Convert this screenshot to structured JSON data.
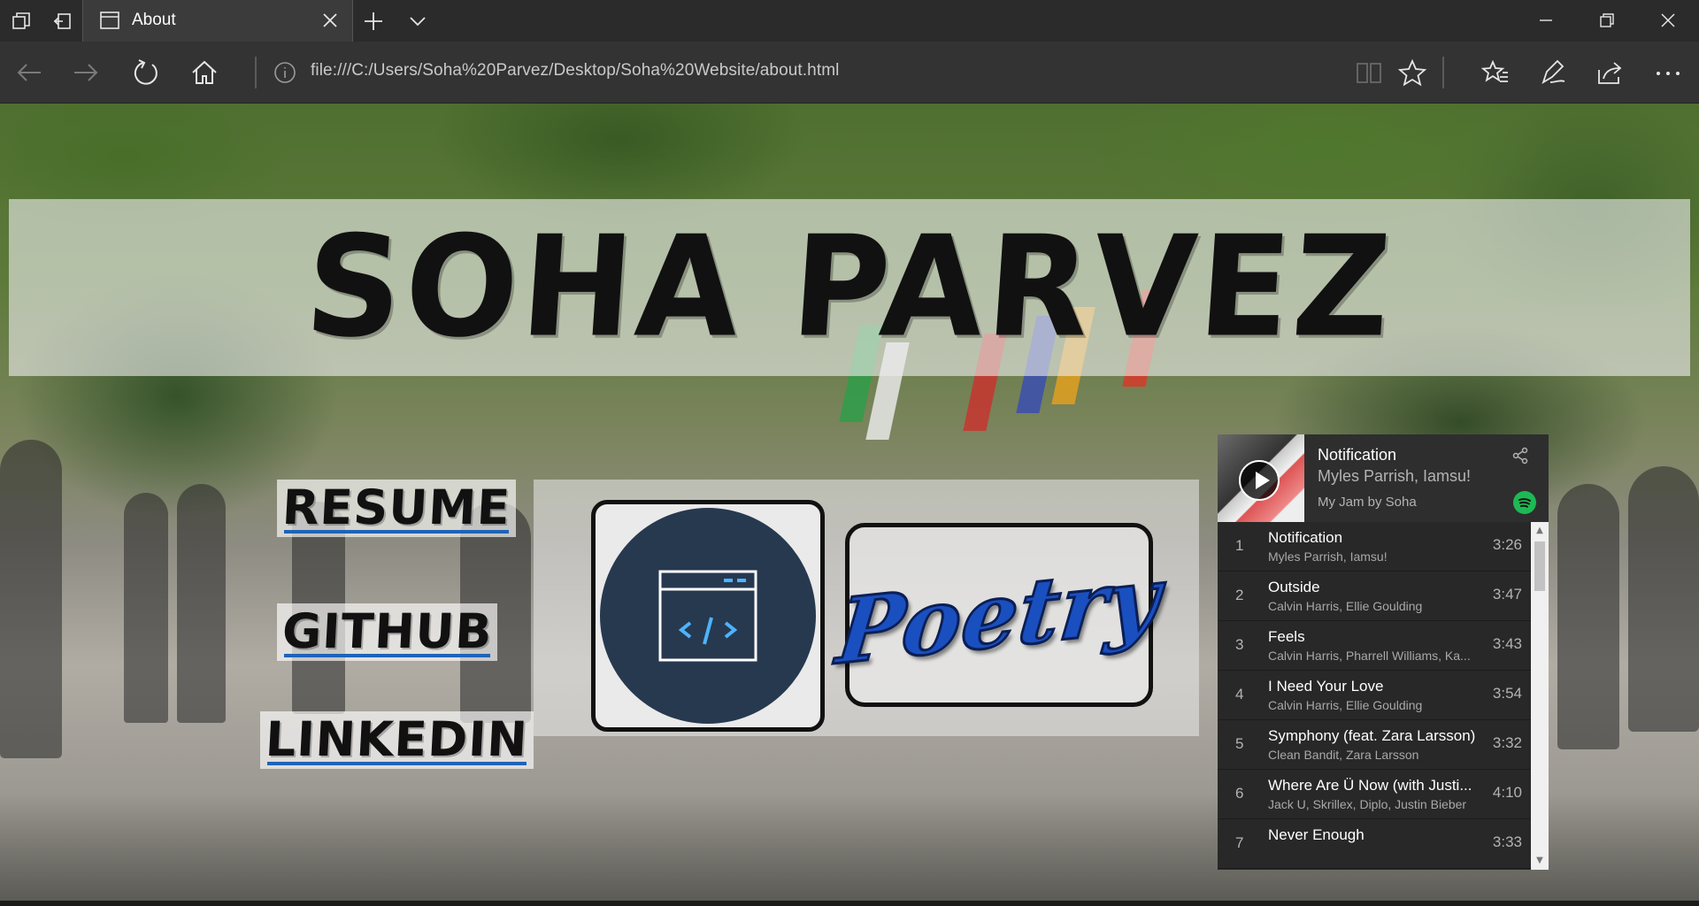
{
  "browser": {
    "tab": {
      "title": "About"
    },
    "address": {
      "url": "file:///C:/Users/Soha%20Parvez/Desktop/Soha%20Website/about.html"
    }
  },
  "page": {
    "name": "SOHA PARVEZ",
    "links": {
      "resume": "RESUME",
      "github": "GITHUB",
      "linkedin": "LINKEDIN"
    },
    "poetry": "Poetry"
  },
  "spotify": {
    "now_playing": {
      "title": "Notification",
      "artist": "Myles Parrish, Iamsu!",
      "playlist": "My Jam by Soha"
    },
    "tracks": [
      {
        "num": "1",
        "title": "Notification",
        "artist": "Myles Parrish, Iamsu!",
        "duration": "3:26"
      },
      {
        "num": "2",
        "title": "Outside",
        "artist": "Calvin Harris, Ellie Goulding",
        "duration": "3:47"
      },
      {
        "num": "3",
        "title": "Feels",
        "artist": "Calvin Harris, Pharrell Williams, Ka...",
        "duration": "3:43"
      },
      {
        "num": "4",
        "title": "I Need Your Love",
        "artist": "Calvin Harris, Ellie Goulding",
        "duration": "3:54"
      },
      {
        "num": "5",
        "title": "Symphony (feat. Zara Larsson)",
        "artist": "Clean Bandit, Zara Larsson",
        "duration": "3:32"
      },
      {
        "num": "6",
        "title": "Where Are Ü Now (with Justi...",
        "artist": "Jack U, Skrillex, Diplo, Justin Bieber",
        "duration": "4:10"
      },
      {
        "num": "7",
        "title": "Never Enough",
        "artist": "",
        "duration": "3:33"
      }
    ]
  },
  "colors": {
    "chrome_dark": "#2b2b2b",
    "link_underline": "#1e63b8",
    "code_circle": "#27394f",
    "spotify_green": "#1db954"
  },
  "icons": [
    "tab-preview-icon",
    "set-aside-tabs-icon",
    "page-icon",
    "close-icon",
    "plus-icon",
    "chevron-down-icon",
    "minimize-icon",
    "restore-icon",
    "back-icon",
    "forward-icon",
    "refresh-icon",
    "home-icon",
    "info-icon",
    "reading-view-icon",
    "star-icon",
    "favorites-icon",
    "pen-icon",
    "share-icon",
    "more-icon",
    "code-window-icon",
    "play-icon",
    "spotify-logo-icon"
  ]
}
